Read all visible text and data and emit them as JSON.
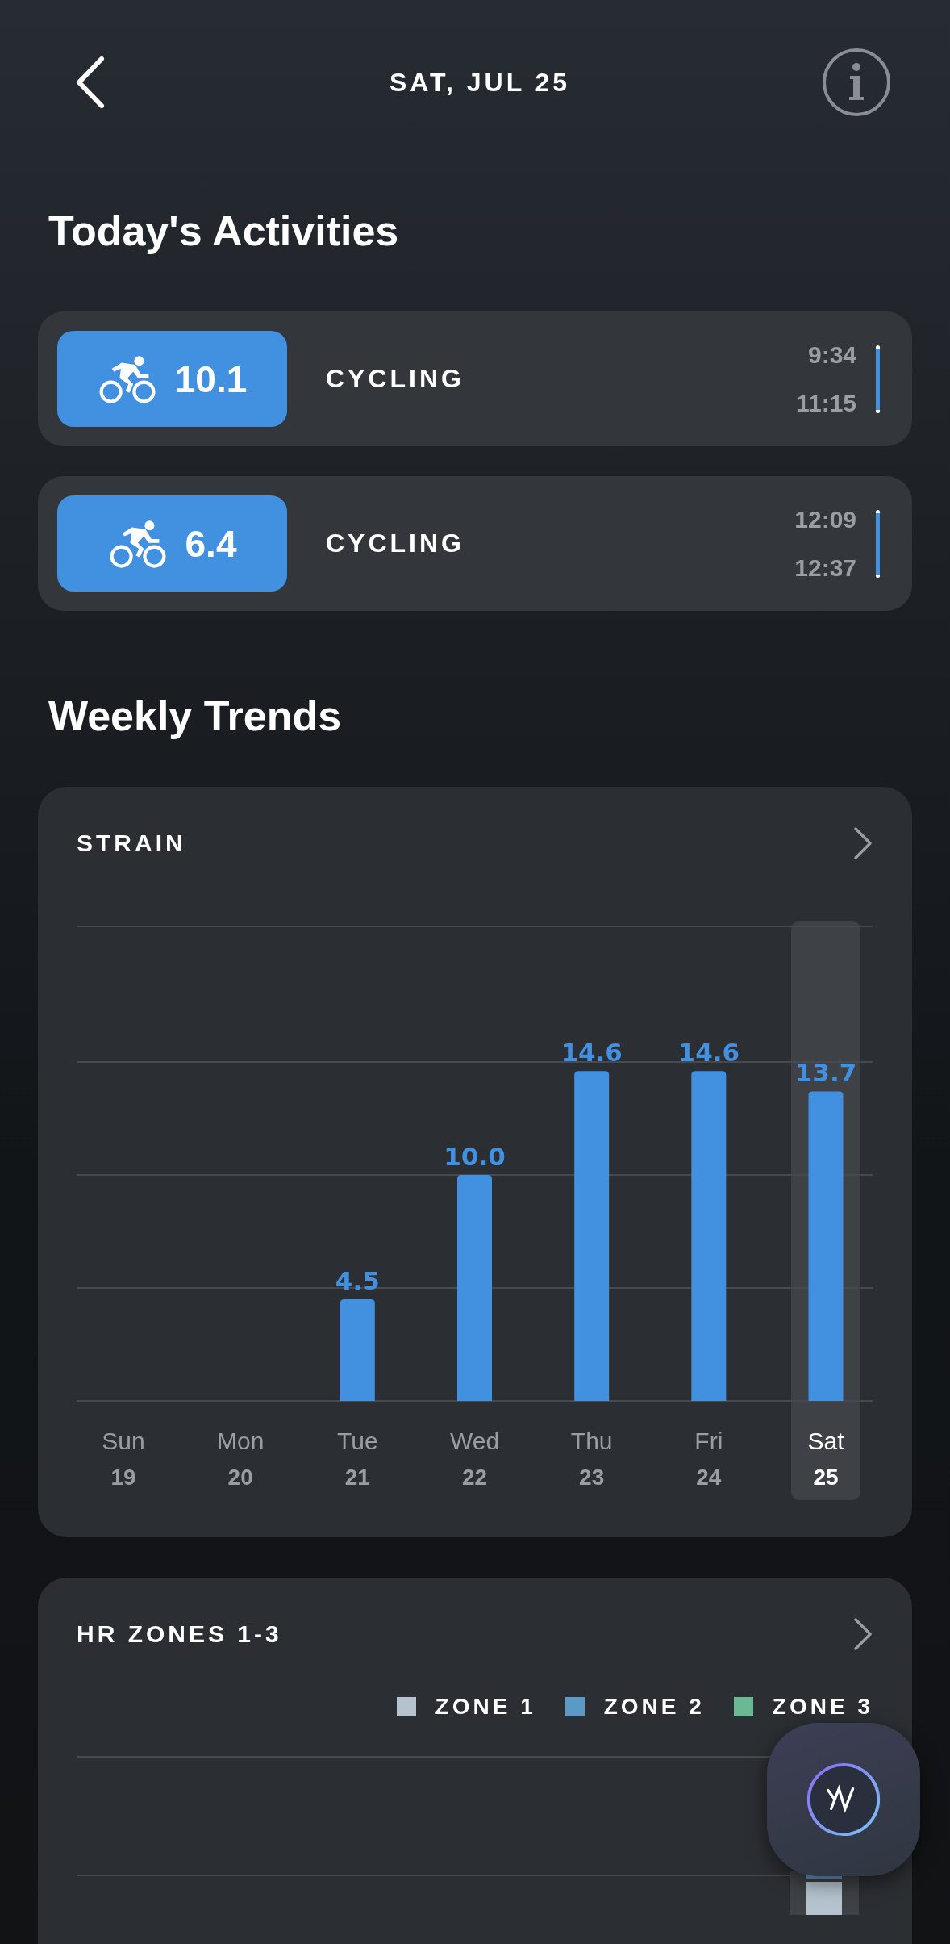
{
  "header": {
    "title": "SAT, JUL 25"
  },
  "activities": {
    "title": "Today's Activities",
    "items": [
      {
        "score": "10.1",
        "name": "CYCLING",
        "start": "9:34",
        "end": "11:15"
      },
      {
        "score": "6.4",
        "name": "CYCLING",
        "start": "12:09",
        "end": "12:37"
      }
    ]
  },
  "weekly_trends": {
    "title": "Weekly Trends",
    "strain": {
      "title": "STRAIN",
      "chart_data": {
        "type": "bar",
        "categories": [
          "Sun 19",
          "Mon 20",
          "Tue 21",
          "Wed 22",
          "Thu 23",
          "Fri 24",
          "Sat 25"
        ],
        "values": [
          null,
          null,
          4.5,
          10.0,
          14.6,
          14.6,
          13.7
        ],
        "value_labels": [
          null,
          null,
          "4.5",
          "10.0",
          "14.6",
          "14.6",
          "13.7"
        ],
        "ylim": [
          0,
          21
        ]
      },
      "days": [
        {
          "selected": false
        },
        {
          "selected": false
        },
        {
          "selected": false
        },
        {
          "selected": false
        },
        {
          "selected": false
        },
        {
          "selected": false
        },
        {
          "selected": true
        }
      ]
    },
    "hr_zones": {
      "title": "HR ZONES 1-3",
      "legend": [
        {
          "label": "ZONE 1",
          "color": "#b4c3ce"
        },
        {
          "label": "ZONE 2",
          "color": "#5b9ac6"
        },
        {
          "label": "ZONE 3",
          "color": "#6bb894"
        }
      ]
    }
  }
}
